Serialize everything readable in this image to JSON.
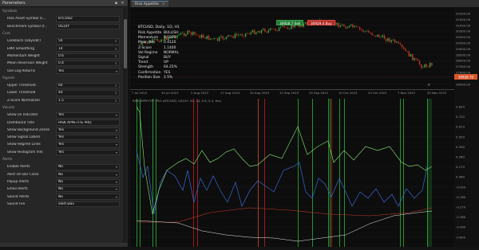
{
  "params_panel": {
    "title": "Parameters",
    "sections": [
      {
        "header": "Symbols",
        "rows": [
          {
            "label": "Risk Asset Symbol (C...",
            "value": "BTCUSD",
            "control": "none"
          },
          {
            "label": "Benchmark Symbol (f...",
            "value": "US10Y",
            "control": "none"
          }
        ]
      },
      {
        "header": "Core",
        "rows": [
          {
            "label": "Lookback (Days/Br)",
            "value": "50",
            "control": "spin"
          },
          {
            "label": "EMA Smoothing",
            "value": "14",
            "control": "spin"
          },
          {
            "label": "Momentum Weight",
            "value": "0.6",
            "control": "spin"
          },
          {
            "label": "Mean Reversion Weight",
            "value": "0.4",
            "control": "spin"
          },
          {
            "label": "Use Log Returns",
            "value": "Yes",
            "control": "dropdown"
          }
        ]
      },
      {
        "header": "Signals",
        "rows": [
          {
            "label": "Upper Threshold",
            "value": "60",
            "control": "spin"
          },
          {
            "label": "Lower Threshold",
            "value": "40",
            "control": "spin"
          },
          {
            "label": "Z-Score Normalizer",
            "value": "1.5",
            "control": "spin"
          }
        ]
      },
      {
        "header": "Visuals",
        "rows": [
          {
            "label": "Show on Indicator",
            "value": "Yes",
            "control": "dropdown"
          },
          {
            "label": "Dashboard Title",
            "value": "RISK APPETITE PRO",
            "control": "none"
          },
          {
            "label": "Show Background Zones",
            "value": "Yes",
            "control": "dropdown"
          },
          {
            "label": "Show Signal Labels",
            "value": "Yes",
            "control": "dropdown"
          },
          {
            "label": "Show Regime Lines",
            "value": "Yes",
            "control": "dropdown"
          },
          {
            "label": "Show Histogram Info",
            "value": "Yes",
            "control": "dropdown"
          }
        ]
      },
      {
        "header": "Alerts",
        "rows": [
          {
            "label": "Enable Alerts",
            "value": "No",
            "control": "dropdown"
          },
          {
            "label": "Alert On Bar Close",
            "value": "No",
            "control": "dropdown"
          },
          {
            "label": "Popup Alerts",
            "value": "No",
            "control": "dropdown"
          },
          {
            "label": "Email Alerts",
            "value": "No",
            "control": "dropdown"
          },
          {
            "label": "Sound Alerts",
            "value": "No",
            "control": "dropdown"
          },
          {
            "label": "Sound File",
            "value": "alert.wav",
            "control": "none"
          }
        ]
      }
    ]
  },
  "chart_window": {
    "tab_title": "Risk Appetite",
    "close_glyph": "×",
    "symbol_label": "BTCUSD, Daily, 1D, H1",
    "sell_price": "30928.7",
    "sell_label": "Sell",
    "buy_price": "30929.4",
    "buy_label": "Buy",
    "current_price_tag": "30928.70",
    "info_lines": [
      {
        "k": "Risk Appetite",
        "v": "BULLISH"
      },
      {
        "k": "Momentum",
        "v": "0.5820"
      },
      {
        "k": "Mean Rev",
        "v": "0.4120"
      },
      {
        "k": "Z-Score",
        "v": "1.1400"
      },
      {
        "k": "Vol Regime",
        "v": "NORMAL"
      },
      {
        "k": "Signal",
        "v": "BUY"
      },
      {
        "k": "Trend",
        "v": "UP"
      },
      {
        "k": "Strength",
        "v": "64.25%"
      },
      {
        "k": "Confirmation",
        "v": "YES"
      },
      {
        "k": "Position Size",
        "v": "2.5%"
      }
    ],
    "price_axis": [
      "32000.00",
      "31500.00",
      "31000.00",
      "30500.00",
      "30000.00",
      "29500.00",
      "29000.00",
      "28500.00",
      "28000.00",
      "27500.00",
      "27000.00",
      "26500.00",
      "26000.00"
    ],
    "time_axis": [
      "7 Jul 2023",
      "20 Jul 2023",
      "2 Aug 2023",
      "17 Aug 2023",
      "30 Aug 2023",
      "12 Sep 2023",
      "25 Sep 2023",
      "10 Oct 2023",
      "23 Oct 2023",
      "7 Nov 2023",
      "20 Nov 2023"
    ],
    "indicator_axis": [
      "0.830",
      "0.720",
      "0.610",
      "0.500",
      "0.390",
      "0.280",
      "0.170",
      "0.060",
      "-0.050",
      "-0.160",
      "-0.270",
      "-0.380",
      "-0.490",
      "-0.600"
    ],
    "indicator_header": "RISK APPETITE PRO (BTCUSD, US10Y, 50, 14, 0.6, 0.4, Yes)",
    "colors": {
      "bull_candle": "#3ea63e",
      "bear_candle": "#c0392b",
      "zone_green": "#2ecc40",
      "zone_red": "#e02020",
      "line_green": "#7ed36a",
      "line_blue": "#3a67d6",
      "line_red": "#c0392b",
      "line_white": "#e8e8e8"
    }
  }
}
